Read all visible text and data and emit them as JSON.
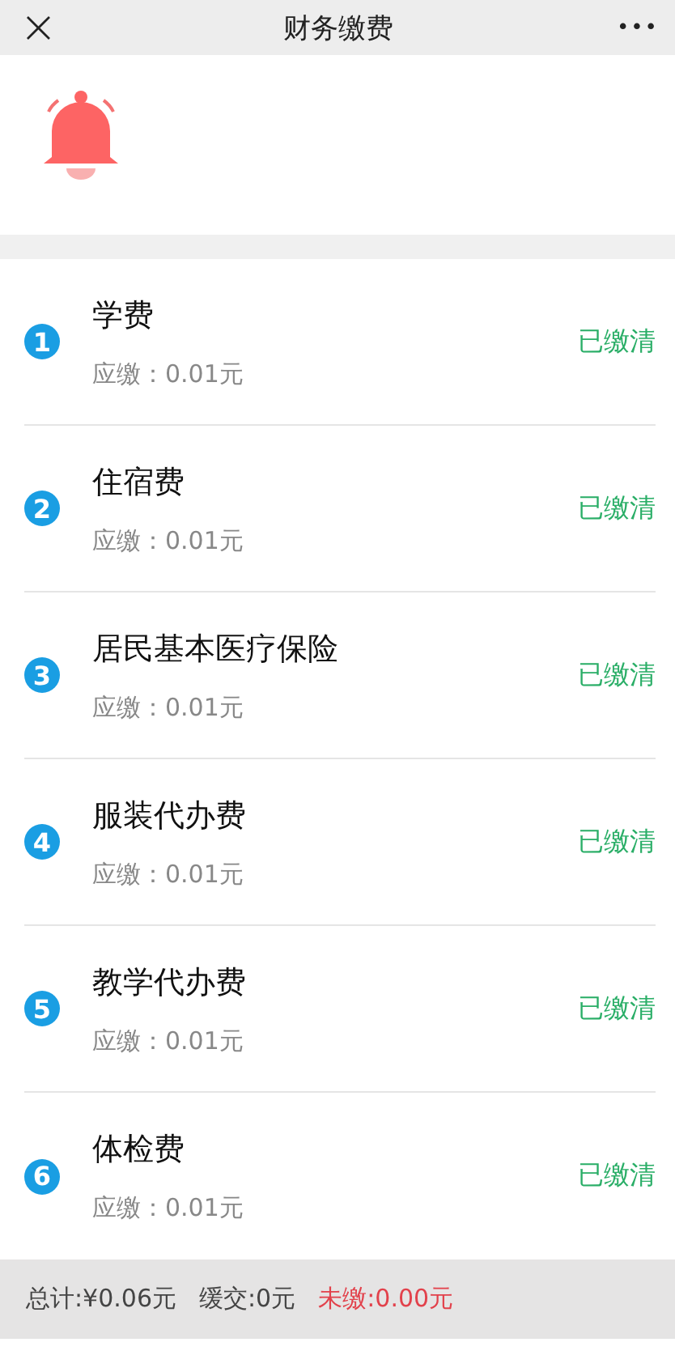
{
  "header": {
    "close": "×",
    "title": "财务缴费",
    "more": "•••"
  },
  "fees": [
    {
      "number": "1",
      "name": "学费",
      "due": "应缴：0.01元",
      "status": "已缴清"
    },
    {
      "number": "2",
      "name": "住宿费",
      "due": "应缴：0.01元",
      "status": "已缴清"
    },
    {
      "number": "3",
      "name": "居民基本医疗保险",
      "due": "应缴：0.01元",
      "status": "已缴清"
    },
    {
      "number": "4",
      "name": "服装代办费",
      "due": "应缴：0.01元",
      "status": "已缴清"
    },
    {
      "number": "5",
      "name": "教学代办费",
      "due": "应缴：0.01元",
      "status": "已缴清"
    },
    {
      "number": "6",
      "name": "体检费",
      "due": "应缴：0.01元",
      "status": "已缴清"
    }
  ],
  "summary": {
    "total": "总计:¥0.06元",
    "deferred": "缓交:0元",
    "unpaid": "未缴:0.00元"
  }
}
